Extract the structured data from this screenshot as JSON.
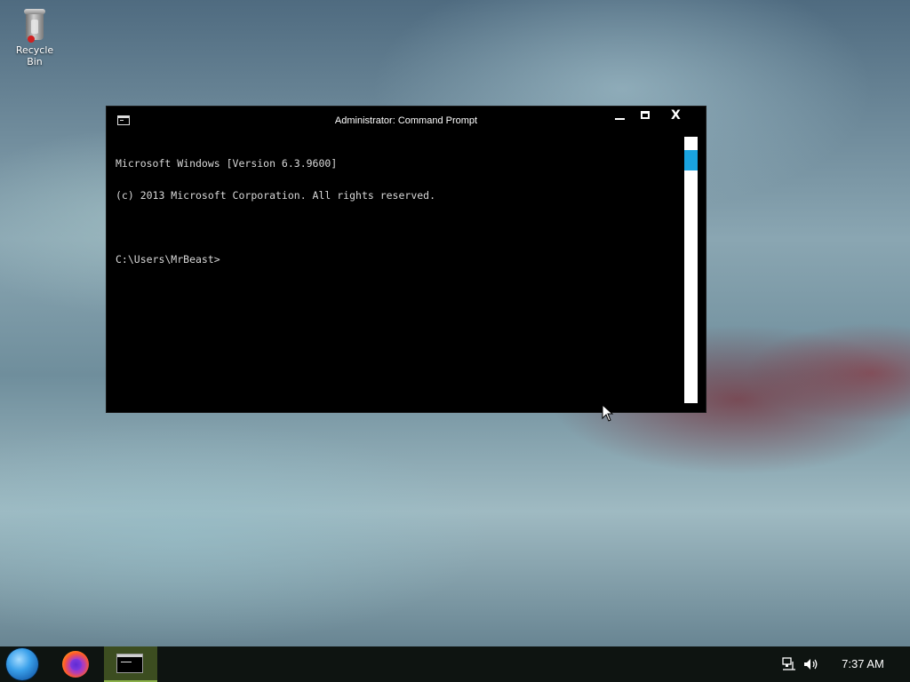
{
  "desktop": {
    "icons": [
      {
        "label": "Recycle Bin",
        "icon": "recycle-bin-icon"
      }
    ]
  },
  "window": {
    "title": "Administrator: Command Prompt",
    "icon": "cmd-icon",
    "controls": {
      "minimize_icon": "minimize-icon",
      "maximize_icon": "maximize-icon",
      "close_icon": "close-icon",
      "close_glyph": "X"
    },
    "console": {
      "lines": [
        "Microsoft Windows [Version 6.3.9600]",
        "(c) 2013 Microsoft Corporation. All rights reserved.",
        "",
        "C:\\Users\\MrBeast>"
      ],
      "text_color": "#d8d8d8",
      "background": "#000000"
    },
    "scrollbar": {
      "thumb_color": "#1aa3e0"
    }
  },
  "taskbar": {
    "start_icon": "start-orb-icon",
    "items": [
      {
        "name": "Firefox",
        "icon": "firefox-icon",
        "active": false
      },
      {
        "name": "Command Prompt",
        "icon": "cmd-icon",
        "active": true
      }
    ],
    "tray": {
      "network_icon": "network-icon",
      "volume_icon": "speaker-icon",
      "clock": "7:37 AM"
    },
    "active_color": "#3c4d20"
  }
}
